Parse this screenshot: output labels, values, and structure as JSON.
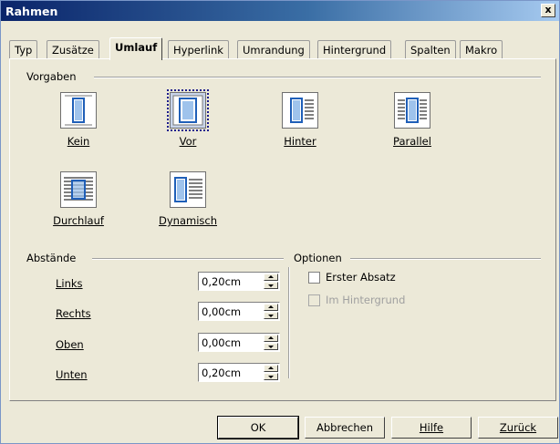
{
  "window": {
    "title": "Rahmen",
    "close_label": "x"
  },
  "tabs": [
    {
      "label": "Typ"
    },
    {
      "label": "Zusätze"
    },
    {
      "label": "Umlauf",
      "active": true
    },
    {
      "label": "Hyperlink"
    },
    {
      "label": "Umrandung"
    },
    {
      "label": "Hintergrund"
    },
    {
      "label": "Spalten"
    },
    {
      "label": "Makro"
    }
  ],
  "vorgaben": {
    "label": "Vorgaben",
    "options": [
      {
        "label": "Kein",
        "selected": false
      },
      {
        "label": "Vor",
        "selected": true
      },
      {
        "label": "Hinter",
        "selected": false
      },
      {
        "label": "Parallel",
        "selected": false
      },
      {
        "label": "Durchlauf",
        "selected": false
      },
      {
        "label": "Dynamisch",
        "selected": false
      }
    ]
  },
  "abstaende": {
    "label": "Abstände",
    "rows": [
      {
        "label": "Links",
        "value": "0,20cm"
      },
      {
        "label": "Rechts",
        "value": "0,00cm"
      },
      {
        "label": "Oben",
        "value": "0,00cm"
      },
      {
        "label": "Unten",
        "value": "0,20cm"
      }
    ]
  },
  "optionen": {
    "label": "Optionen",
    "erster_absatz": {
      "label": "Erster Absatz",
      "checked": false,
      "enabled": true
    },
    "im_hintergrund": {
      "label": "Im Hintergrund",
      "checked": false,
      "enabled": false
    }
  },
  "buttons": {
    "ok": "OK",
    "abbrechen": "Abbrechen",
    "hilfe": "Hilfe",
    "zurueck": "Zurück"
  }
}
